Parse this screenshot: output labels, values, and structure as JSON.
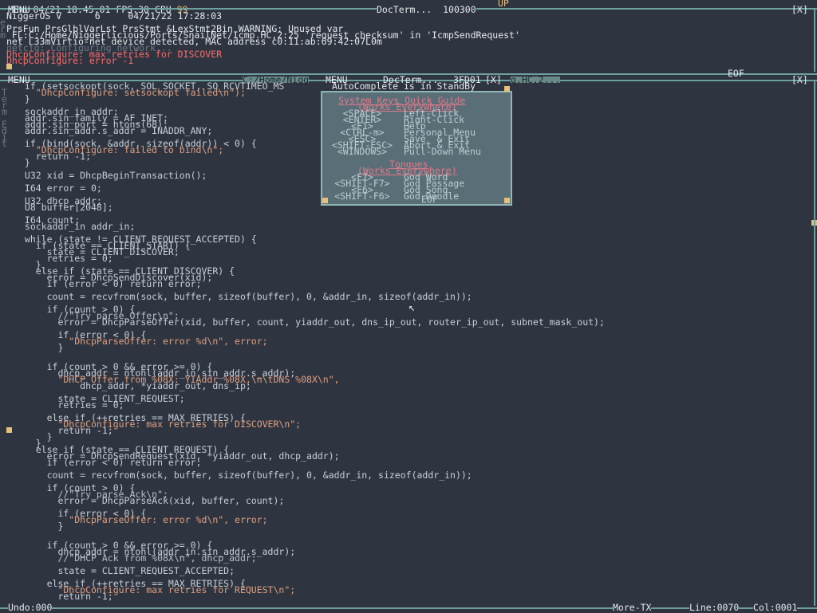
{
  "topbar": {
    "datetime": "Thu 04/21 18:45:01 FPS:30 CPU",
    "cpu_value": "99",
    "up_label": "UP"
  },
  "system_window": {
    "menu_label": "MENU",
    "title": "DocTerm...",
    "title_extra": "100300",
    "close": "[X]",
    "lines": [
      "NiggerOS V      6     04/21/22 17:28:03",
      "PrsFun PrsGlblVarLst PrsStmt &LexStmt2Bin WARNING: Unused var",
      " FL:C:/Home/Niggerlicious/Ports/SnailNet/Icmp.HC,2:25 'request_checksum' in 'IcmpSendRequest'",
      "net L33mVirtio-net device detected, MAC address c0:11:ab:69:42:07L0m",
      "netcfg: Configuring network...",
      "DhcpConfigure: max retries for DISCOVER",
      "DhcpConfigure: error -1"
    ],
    "side_letters": [
      "e",
      "r",
      "m"
    ],
    "eof": "EOF"
  },
  "editor_window": {
    "menu_label": "MENU",
    "path": "C:/Home/Nigg",
    "menu2": "MENU",
    "title": "DocTerm...",
    "num": "3FD01",
    "close_inner": "[X]",
    "tab": "q.HC,2...",
    "close": "[X]",
    "side_letters": [
      "T",
      "e",
      "r",
      "m",
      "",
      "E",
      "d",
      "i",
      "t"
    ],
    "autocomplete_banner": "AutoComplete is in StandBy",
    "code": [
      " if (setsockopt(sock, SOL_SOCKET, SO_RCVTIMEO_MS",
      "   \"DhcpConfigure: setsockopt failed\\n\");",
      " }",
      "",
      " sockaddr_in addr;",
      " addr.sin_family = AF_INET;",
      " addr.sin_port = htons(68);",
      " addr.sin_addr.s_addr = INADDR_ANY;",
      "",
      " if (bind(sock, &addr, sizeof(addr)) < 0) {",
      "   \"DhcpConfigure: failed to bind\\n\";",
      "   return -1;",
      " }",
      "",
      " U32 xid = DhcpBeginTransaction();",
      "",
      " I64 error = 0;",
      "",
      " U32 dhcp_addr;",
      " U8 buffer[2048];",
      "",
      " I64 count;",
      " sockaddr_in addr_in;",
      "",
      " while (state != CLIENT_REQUEST_ACCEPTED) {",
      "   if (state == CLIENT_START) {",
      "     state = CLIENT_DISCOVER;",
      "     retries = 0;",
      "   }",
      "   else if (state == CLIENT_DISCOVER) {",
      "     error = DhcpSendDiscover(xid);",
      "     if (error < 0) return error;",
      "",
      "     count = recvfrom(sock, buffer, sizeof(buffer), 0, &addr_in, sizeof(addr_in));",
      "",
      "     if (count > 0) {",
      "       //\"Try parse Offer\\n\";",
      "       error = DhcpParseOffer(xid, buffer, count, yiaddr_out, dns_ip_out, router_ip_out, subnet_mask_out);",
      "",
      "       if (error < 0) {",
      "         \"DhcpParseOffer: error %d\\n\", error;",
      "       }",
      "",
      "",
      "     if (count > 0 && error >= 0) {",
      "       dhcp_addr = ntohl(addr_in.sin_addr.s_addr);",
      "       \"DHCP Offer from %08X: YIAddr %08X,\\n\\tDNS %08X\\n\",",
      "           dhcp_addr, *yiaddr_out, dns_ip;",
      "",
      "       state = CLIENT_REQUEST;",
      "       retries = 0;",
      "",
      "     else if (++retries == MAX_RETRIES) {",
      "       \"DhcpConfigure: max retries for DISCOVER\\n\";",
      "       return -1;",
      "     }",
      "   }",
      "   else if (state == CLIENT_REQUEST) {",
      "     error = DhcpSendRequest(xid, *yiaddr_out, dhcp_addr);",
      "     if (error < 0) return error;",
      "",
      "     count = recvfrom(sock, buffer, sizeof(buffer), 0, &addr_in, sizeof(addr_in));",
      "",
      "     if (count > 0) {",
      "       //\"Try parse Ack\\n\";",
      "       error = DhcpParseAck(xid, buffer, count);",
      "",
      "       if (error < 0) {",
      "         \"DhcpParseOffer: error %d\\n\", error;",
      "       }",
      "",
      "",
      "     if (count > 0 && error >= 0) {",
      "       dhcp_addr = ntohl(addr_in.sin_addr.s_addr);",
      "       //\"DHCP Ack from %08X\\n\", dhcp_addr;",
      "",
      "       state = CLIENT_REQUEST_ACCEPTED;",
      "",
      "     else if (++retries == MAX_RETRIES) {",
      "       \"DhcpConfigure: max retries for REQUEST\\n\";",
      "       return -1;"
    ],
    "eof": "EOF"
  },
  "popup": {
    "title": "System Keys Quick Guide",
    "subtitle": "(Works Everywhere)",
    "keys": [
      {
        "key": "<SPACE>",
        "action": "Left-Click"
      },
      {
        "key": "<ENTER>",
        "action": "Right-Click"
      },
      {
        "key": "<F1>",
        "action": "Help"
      },
      {
        "key": "<CTRL-m>",
        "action": "Personal Menu"
      },
      {
        "key": "<ESC>",
        "action": "Save  & Exit"
      },
      {
        "key": "<SHIFT-ESC>",
        "action": "Abort & Exit"
      },
      {
        "key": "<WINDOWS>",
        "action": "Pull-Down Menu"
      }
    ],
    "tongues_title": "Tongues",
    "tongues_subtitle": "(Works Everywhere)",
    "tongues": [
      {
        "key": "<F7>",
        "action": "God Word"
      },
      {
        "key": "<SHIFT-F7>",
        "action": "God Passage"
      },
      {
        "key": "<F6>",
        "action": "God Song"
      },
      {
        "key": "<SHIFT-F6>",
        "action": "God Doodle"
      }
    ],
    "eof": "EOF"
  },
  "statusbar": {
    "undo": "Undo:000",
    "more": "More-TX",
    "line": "Line:0070",
    "col": "Col:0001"
  }
}
